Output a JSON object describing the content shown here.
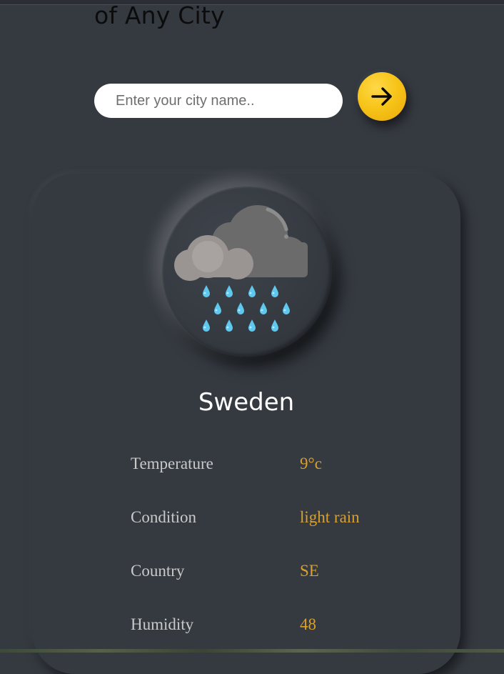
{
  "header": {
    "title": "of Any City"
  },
  "search": {
    "placeholder": "Enter your city name..",
    "value": "",
    "button_icon": "arrow-right-icon"
  },
  "weather": {
    "icon": "rain-cloud-icon",
    "city": "Sweden",
    "stats": [
      {
        "label": "Temperature",
        "value": "9°c"
      },
      {
        "label": "Condition",
        "value": "light rain"
      },
      {
        "label": "Country",
        "value": "SE"
      },
      {
        "label": "Humidity",
        "value": "48"
      }
    ]
  },
  "colors": {
    "background": "#353a41",
    "accent": "#f7c51a",
    "value_text": "#d9a02e",
    "label_text": "#c9c9c9",
    "rain_drop": "#5fc8ef"
  }
}
